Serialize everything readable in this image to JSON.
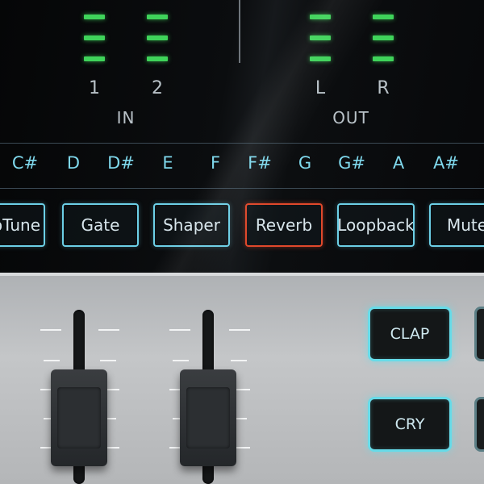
{
  "meters": {
    "in": {
      "label": "IN",
      "channels": [
        "1",
        "2"
      ]
    },
    "out": {
      "label": "OUT",
      "channels": [
        "L",
        "R"
      ]
    }
  },
  "notes": [
    "C#",
    "D",
    "D#",
    "E",
    "F",
    "F#",
    "G",
    "G#",
    "A",
    "A#"
  ],
  "effects": [
    {
      "label": "oTune",
      "active": false
    },
    {
      "label": "Gate",
      "active": false
    },
    {
      "label": "Shaper",
      "active": false
    },
    {
      "label": "Reverb",
      "active": true
    },
    {
      "label": "Loopback",
      "active": false
    },
    {
      "label": "Mute",
      "active": false
    }
  ],
  "pads": {
    "clap": "CLAP",
    "cry": "CRY"
  },
  "colors": {
    "meter_green": "#3fd35a",
    "accent_cyan": "#6ccfe6",
    "active_red": "#e0482b"
  }
}
